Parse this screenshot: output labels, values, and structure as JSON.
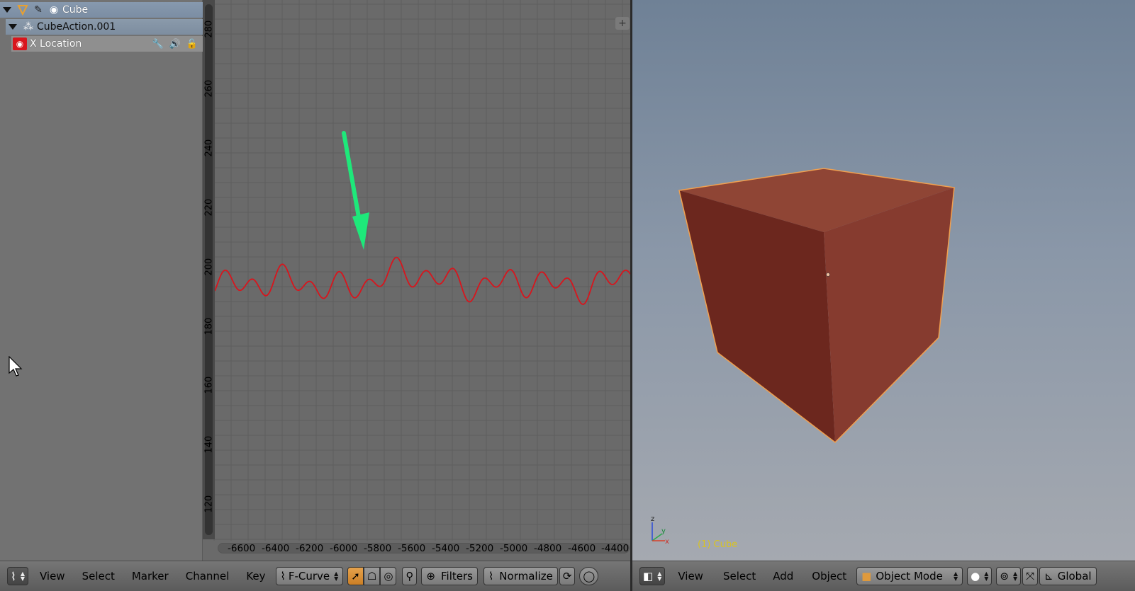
{
  "channels": {
    "object_label": "Cube",
    "action_label": "CubeAction.001",
    "fcurve_label": "X Location"
  },
  "graph": {
    "y_ticks": [
      "280",
      "260",
      "240",
      "220",
      "200",
      "180",
      "160",
      "140",
      "120"
    ],
    "x_ticks": [
      "-6600",
      "-6400",
      "-6200",
      "-6000",
      "-5800",
      "-5600",
      "-5400",
      "-5200",
      "-5000",
      "-4800",
      "-4600",
      "-4400"
    ],
    "curve_color": "#d8151d",
    "annotation_arrow_color": "#1ee87a"
  },
  "viewport": {
    "object_label": "(1) Cube",
    "axis_labels": {
      "z": "z",
      "y": "y",
      "x": "x"
    }
  },
  "graph_header": {
    "menus": [
      "View",
      "Select",
      "Marker",
      "Channel",
      "Key"
    ],
    "mode_label": "F-Curve",
    "filters_label": "Filters",
    "normalize_label": "Normalize"
  },
  "view_header": {
    "menus": [
      "View",
      "Select",
      "Add",
      "Object"
    ],
    "mode_label": "Object Mode",
    "orientation_label": "Global"
  }
}
